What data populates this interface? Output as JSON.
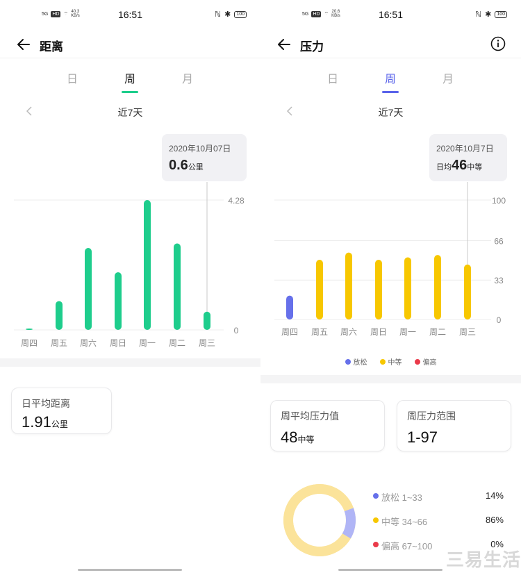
{
  "status_bar": {
    "left": {
      "time": "16:51",
      "network": "5G",
      "hd": "HD",
      "speed": "40.3",
      "speed_unit": "KB/s",
      "battery": "100"
    },
    "right": {
      "time": "16:51",
      "network": "5G",
      "hd": "HD",
      "speed": "20.6",
      "speed_unit": "KB/s",
      "battery": "100"
    }
  },
  "left": {
    "title": "距离",
    "tabs": [
      "日",
      "周",
      "月"
    ],
    "active_tab": "周",
    "range_label": "近7天",
    "tooltip": {
      "date": "2020年10月07日",
      "value": "0.6",
      "unit": "公里"
    },
    "summary": {
      "label": "日平均距离",
      "value": "1.91",
      "unit": "公里"
    },
    "colors": {
      "accent": "#1ecd8c",
      "gridline": "#e8e8e8"
    }
  },
  "right": {
    "title": "压力",
    "tabs": [
      "日",
      "周",
      "月"
    ],
    "active_tab": "周",
    "range_label": "近7天",
    "tooltip": {
      "date": "2020年10月7日",
      "prefix": "日均",
      "value": "46",
      "unit": "中等"
    },
    "legend": [
      {
        "label": "放松",
        "color": "#6670ea"
      },
      {
        "label": "中等",
        "color": "#f7c700"
      },
      {
        "label": "偏高",
        "color": "#ea3a4a"
      }
    ],
    "avg_card": {
      "label": "周平均压力值",
      "value": "48",
      "unit": "中等"
    },
    "range_card": {
      "label": "周压力范围",
      "value": "1-97"
    },
    "distribution": [
      {
        "label": "放松 1~33",
        "pct": "14%",
        "color": "#6670ea",
        "fraction": 0.14
      },
      {
        "label": "中等 34~66",
        "pct": "86%",
        "color": "#f7c700",
        "fraction": 0.86
      },
      {
        "label": "偏高 67~100",
        "pct": "0%",
        "color": "#ea3a4a",
        "fraction": 0
      }
    ],
    "donut_colors": {
      "relax": "#b0b5f6",
      "moderate": "#fbe39a"
    },
    "colors": {
      "accent": "#5a64ea"
    }
  },
  "chart_data": [
    {
      "type": "bar",
      "categories": [
        "周四",
        "周五",
        "周六",
        "周日",
        "周一",
        "周二",
        "周三"
      ],
      "values": [
        0.0,
        0.95,
        2.7,
        1.9,
        4.28,
        2.85,
        0.6
      ],
      "y_ticks": [
        "4.28",
        "0"
      ],
      "ylim": [
        0,
        4.28
      ],
      "selected_index": 6,
      "color": "#1ecd8c"
    },
    {
      "type": "bar",
      "categories": [
        "周四",
        "周五",
        "周六",
        "周日",
        "周一",
        "周二",
        "周三"
      ],
      "values": [
        20,
        50,
        56,
        50,
        52,
        54,
        46
      ],
      "bar_colors": [
        "#6670ea",
        "#f7c700",
        "#f7c700",
        "#f7c700",
        "#f7c700",
        "#f7c700",
        "#f7c700"
      ],
      "y_ticks": [
        "100",
        "66",
        "33",
        "0"
      ],
      "ylim": [
        0,
        100
      ],
      "selected_index": 6
    }
  ],
  "watermark": "三易生活"
}
